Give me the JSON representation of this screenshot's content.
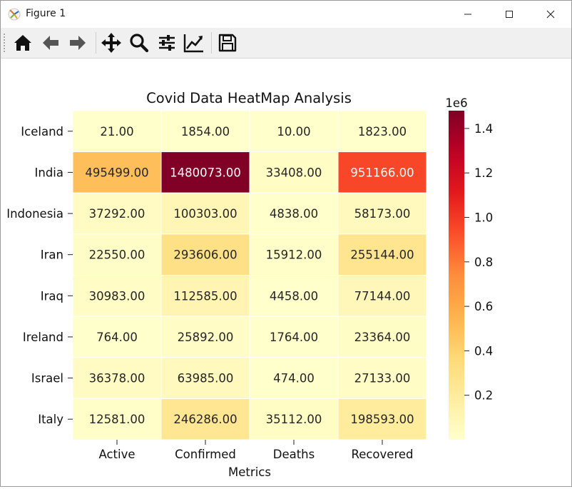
{
  "window": {
    "title": "Figure 1"
  },
  "toolbar": {
    "icons": [
      "home-icon",
      "back-arrow-icon",
      "forward-arrow-icon",
      "pan-icon",
      "zoom-icon",
      "configure-subplots-icon",
      "edit-axes-icon",
      "save-icon"
    ]
  },
  "chart_data": {
    "type": "heatmap",
    "title": "Covid Data HeatMap Analysis",
    "xlabel": "Metrics",
    "ylabel": "",
    "columns": [
      "Active",
      "Confirmed",
      "Deaths",
      "Recovered"
    ],
    "rows": [
      "Iceland",
      "India",
      "Indonesia",
      "Iran",
      "Iraq",
      "Ireland",
      "Israel",
      "Italy"
    ],
    "values": [
      [
        21,
        1854,
        10,
        1823
      ],
      [
        495499,
        1480073,
        33408,
        951166
      ],
      [
        37292,
        100303,
        4838,
        58173
      ],
      [
        22550,
        293606,
        15912,
        255144
      ],
      [
        30983,
        112585,
        4458,
        77144
      ],
      [
        764,
        25892,
        1764,
        23364
      ],
      [
        36378,
        63985,
        474,
        27133
      ],
      [
        12581,
        246286,
        35112,
        198593
      ]
    ],
    "cell_labels": [
      [
        "21.00",
        "1854.00",
        "10.00",
        "1823.00"
      ],
      [
        "495499.00",
        "1480073.00",
        "33408.00",
        "951166.00"
      ],
      [
        "37292.00",
        "100303.00",
        "4838.00",
        "58173.00"
      ],
      [
        "22550.00",
        "293606.00",
        "15912.00",
        "255144.00"
      ],
      [
        "30983.00",
        "112585.00",
        "4458.00",
        "77144.00"
      ],
      [
        "764.00",
        "25892.00",
        "1764.00",
        "23364.00"
      ],
      [
        "36378.00",
        "63985.00",
        "474.00",
        "27133.00"
      ],
      [
        "12581.00",
        "246286.00",
        "35112.00",
        "198593.00"
      ]
    ],
    "colormap": "YlOrRd",
    "vmin": 10,
    "vmax": 1480073,
    "colorbar": {
      "multiplier_label": "1e6",
      "ticks": [
        0.2,
        0.4,
        0.6,
        0.8,
        1.0,
        1.2,
        1.4
      ],
      "tick_labels": [
        "0.2",
        "0.4",
        "0.6",
        "0.8",
        "1.0",
        "1.2",
        "1.4"
      ],
      "scale": 1000000
    },
    "cell_border_color": "#ffffff"
  }
}
